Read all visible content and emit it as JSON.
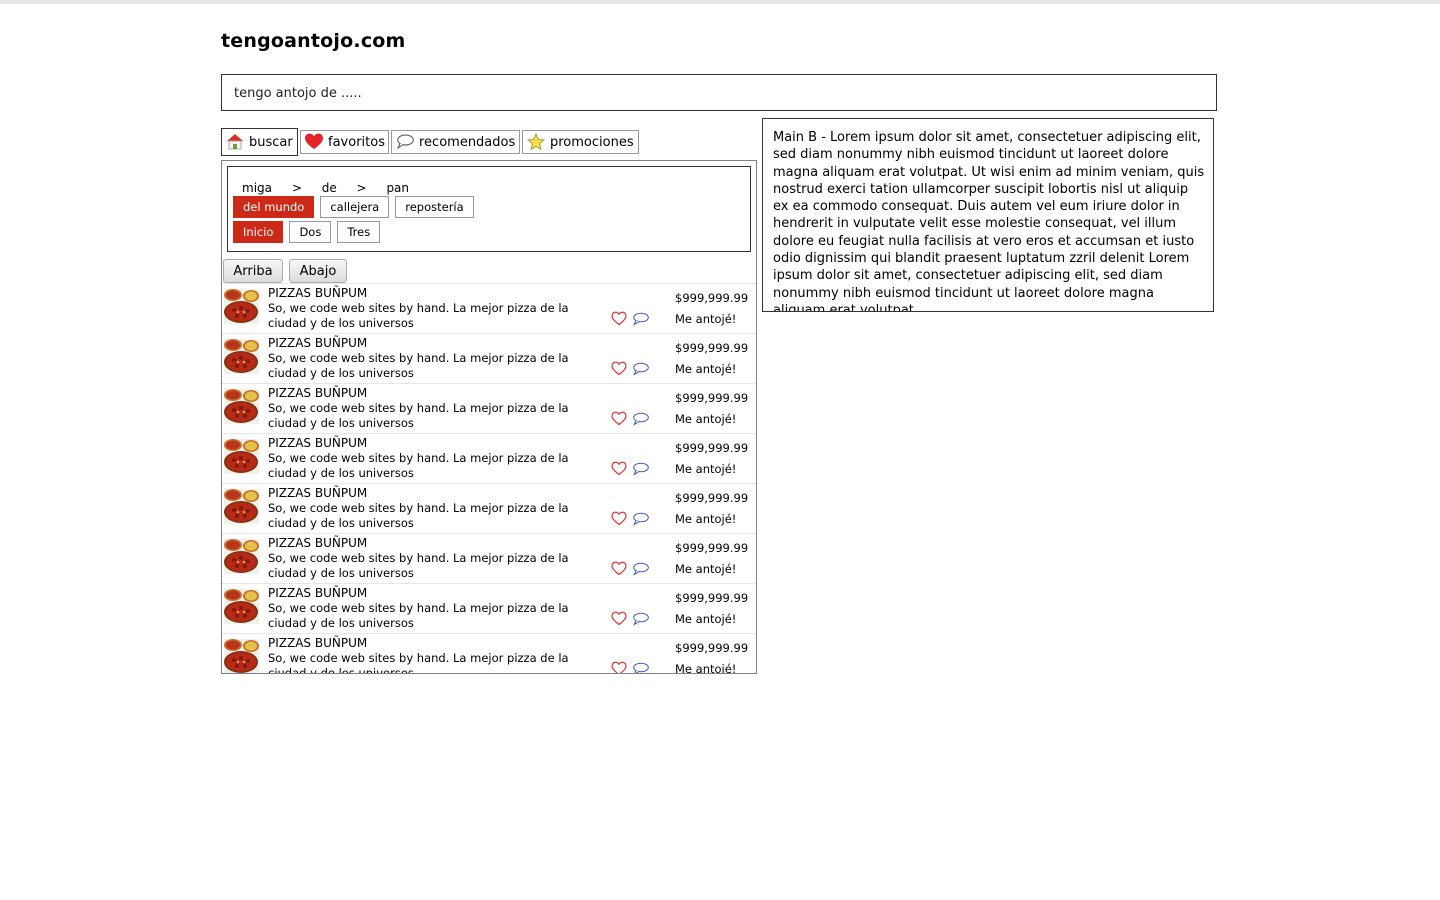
{
  "site": {
    "title": "tengoantojo.com"
  },
  "search": {
    "placeholder": "tengo antojo de ....."
  },
  "tabs": [
    {
      "label": "buscar",
      "icon": "house-icon",
      "active": true
    },
    {
      "label": "favoritos",
      "icon": "heart-icon",
      "active": false
    },
    {
      "label": "recomendados",
      "icon": "speech-bubble-icon",
      "active": false
    },
    {
      "label": "promociones",
      "icon": "star-icon",
      "active": false
    }
  ],
  "breadcrumb": [
    "miga",
    ">",
    "de",
    ">",
    "pan"
  ],
  "categories": [
    {
      "label": "del mundo",
      "selected": true
    },
    {
      "label": "callejera",
      "selected": false
    },
    {
      "label": "repostería",
      "selected": false
    }
  ],
  "pages": [
    {
      "label": "Inicio",
      "selected": true
    },
    {
      "label": "Dos",
      "selected": false
    },
    {
      "label": "Tres",
      "selected": false
    }
  ],
  "nav": {
    "up": "Arriba",
    "down": "Abajo"
  },
  "results": [
    {
      "name": "PIZZAS BUÑPUM",
      "description": "So, we code web sites by hand. La mejor pizza de la ciudad y de los universos",
      "price": "$999,999.99",
      "action": "Me antojé!"
    },
    {
      "name": "PIZZAS BUÑPUM",
      "description": "So, we code web sites by hand. La mejor pizza de la ciudad y de los universos",
      "price": "$999,999.99",
      "action": "Me antojé!"
    },
    {
      "name": "PIZZAS BUÑPUM",
      "description": "So, we code web sites by hand. La mejor pizza de la ciudad y de los universos",
      "price": "$999,999.99",
      "action": "Me antojé!"
    },
    {
      "name": "PIZZAS BUÑPUM",
      "description": "So, we code web sites by hand. La mejor pizza de la ciudad y de los universos",
      "price": "$999,999.99",
      "action": "Me antojé!"
    },
    {
      "name": "PIZZAS BUÑPUM",
      "description": "So, we code web sites by hand. La mejor pizza de la ciudad y de los universos",
      "price": "$999,999.99",
      "action": "Me antojé!"
    },
    {
      "name": "PIZZAS BUÑPUM",
      "description": "So, we code web sites by hand. La mejor pizza de la ciudad y de los universos",
      "price": "$999,999.99",
      "action": "Me antojé!"
    },
    {
      "name": "PIZZAS BUÑPUM",
      "description": "So, we code web sites by hand. La mejor pizza de la ciudad y de los universos",
      "price": "$999,999.99",
      "action": "Me antojé!"
    },
    {
      "name": "PIZZAS BUÑPUM",
      "description": "So, we code web sites by hand. La mejor pizza de la ciudad y de los universos",
      "price": "$999,999.99",
      "action": "Me antojé!"
    }
  ],
  "main_b": {
    "text": "Main B - Lorem ipsum dolor sit amet, consectetuer adipiscing elit, sed diam nonummy nibh euismod tincidunt ut laoreet dolore magna aliquam erat volutpat. Ut wisi enim ad minim veniam, quis nostrud exerci tation ullamcorper suscipit lobortis nisl ut aliquip ex ea commodo consequat. Duis autem vel eum iriure dolor in hendrerit in vulputate velit esse molestie consequat, vel illum dolore eu feugiat nulla facilisis at vero eros et accumsan et iusto odio dignissim qui blandit praesent luptatum zzril delenit Lorem ipsum dolor sit amet, consectetuer adipiscing elit, sed diam nonummy nibh euismod tincidunt ut laoreet dolore magna aliquam erat volutpat"
  },
  "colors": {
    "accent": "#cc2a17",
    "heart": "#e0262b",
    "bubble": "#3d56c4",
    "border": "#333333"
  }
}
